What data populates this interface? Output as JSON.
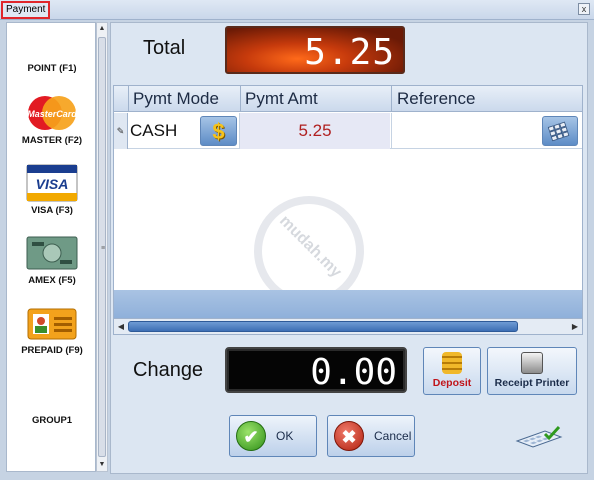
{
  "window": {
    "title": "Payment",
    "close": "x"
  },
  "payment_methods": [
    {
      "label": "POINT (F1)",
      "icon": "point-icon"
    },
    {
      "label": "MASTER (F2)",
      "icon": "mastercard-icon",
      "logo_text": "MasterCard"
    },
    {
      "label": "VISA (F3)",
      "icon": "visa-icon",
      "logo_text": "VISA"
    },
    {
      "label": "AMEX (F5)",
      "icon": "amex-card-icon"
    },
    {
      "label": "PREPAID (F9)",
      "icon": "prepaid-card-icon"
    },
    {
      "label": "GROUP1",
      "icon": ""
    }
  ],
  "total": {
    "label": "Total",
    "value": "5.25"
  },
  "grid": {
    "columns": [
      "Pymt Mode",
      "Pymt Amt",
      "Reference"
    ],
    "rows": [
      {
        "mode": "CASH",
        "amount": "5.25",
        "reference": ""
      }
    ],
    "watermark": "mudah.my"
  },
  "change": {
    "label": "Change",
    "value": "0.00"
  },
  "buttons": {
    "deposit": "Deposit",
    "receipt_printer": "Receipt Printer",
    "ok": "OK",
    "cancel": "Cancel"
  },
  "colors": {
    "total_display": "#c63a0c",
    "change_display": "#050505",
    "amount_text": "#b02020",
    "deposit_text": "#c0141a"
  }
}
